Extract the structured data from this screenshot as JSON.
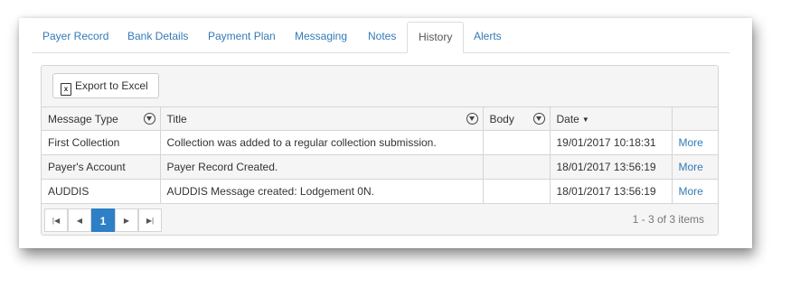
{
  "tabs": [
    {
      "label": "Payer Record"
    },
    {
      "label": "Bank Details"
    },
    {
      "label": "Payment Plan"
    },
    {
      "label": "Messaging"
    },
    {
      "label": "Notes"
    },
    {
      "label": "History",
      "active": true
    },
    {
      "label": "Alerts"
    }
  ],
  "toolbar": {
    "export_label": "Export to Excel"
  },
  "columns": [
    {
      "label": "Message Type",
      "filter": true
    },
    {
      "label": "Title",
      "filter": true
    },
    {
      "label": "Body",
      "filter": true
    },
    {
      "label": "Date",
      "sorted": "descending"
    },
    {
      "label": ""
    }
  ],
  "rows": [
    {
      "type": "First Collection",
      "title": "Collection was added to a regular collection submission.",
      "body": "",
      "date": "19/01/2017 10:18:31",
      "action": "More"
    },
    {
      "type": "Payer's Account",
      "title": "Payer Record Created.",
      "body": "",
      "date": "18/01/2017 13:56:19",
      "action": "More"
    },
    {
      "type": "AUDDIS",
      "title": "AUDDIS Message created: Lodgement 0N.",
      "body": "",
      "date": "18/01/2017 13:56:19",
      "action": "More"
    }
  ],
  "pager": {
    "current_page": "1",
    "info": "1 - 3 of 3 items"
  },
  "colors": {
    "link": "#337ab7",
    "active_page": "#2d7fc6"
  }
}
